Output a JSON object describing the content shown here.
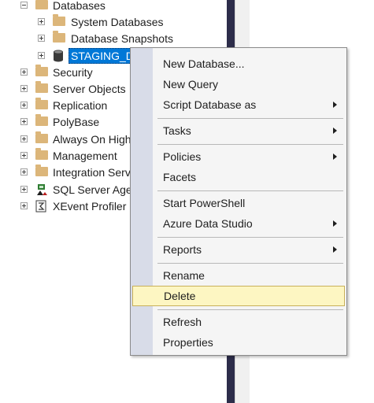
{
  "tree": {
    "databases": "Databases",
    "system_databases": "System Databases",
    "database_snapshots": "Database Snapshots",
    "selected_db": "STAGING_D",
    "security": "Security",
    "server_objects": "Server Objects",
    "replication": "Replication",
    "polybase": "PolyBase",
    "always_on": "Always On High",
    "management": "Management",
    "integration_services": "Integration Serv",
    "sql_server_agent": "SQL Server Agen",
    "xevent_profiler": "XEvent Profiler"
  },
  "context_menu": {
    "new_database": "New Database...",
    "new_query": "New Query",
    "script_database_as": "Script Database as",
    "tasks": "Tasks",
    "policies": "Policies",
    "facets": "Facets",
    "start_powershell": "Start PowerShell",
    "azure_data_studio": "Azure Data Studio",
    "reports": "Reports",
    "rename": "Rename",
    "delete": "Delete",
    "refresh": "Refresh",
    "properties": "Properties"
  },
  "colors": {
    "selection": "#0078d7",
    "highlight": "#fdf6c2",
    "folder": "#dcb67a",
    "splitter": "#2d2d4a"
  }
}
